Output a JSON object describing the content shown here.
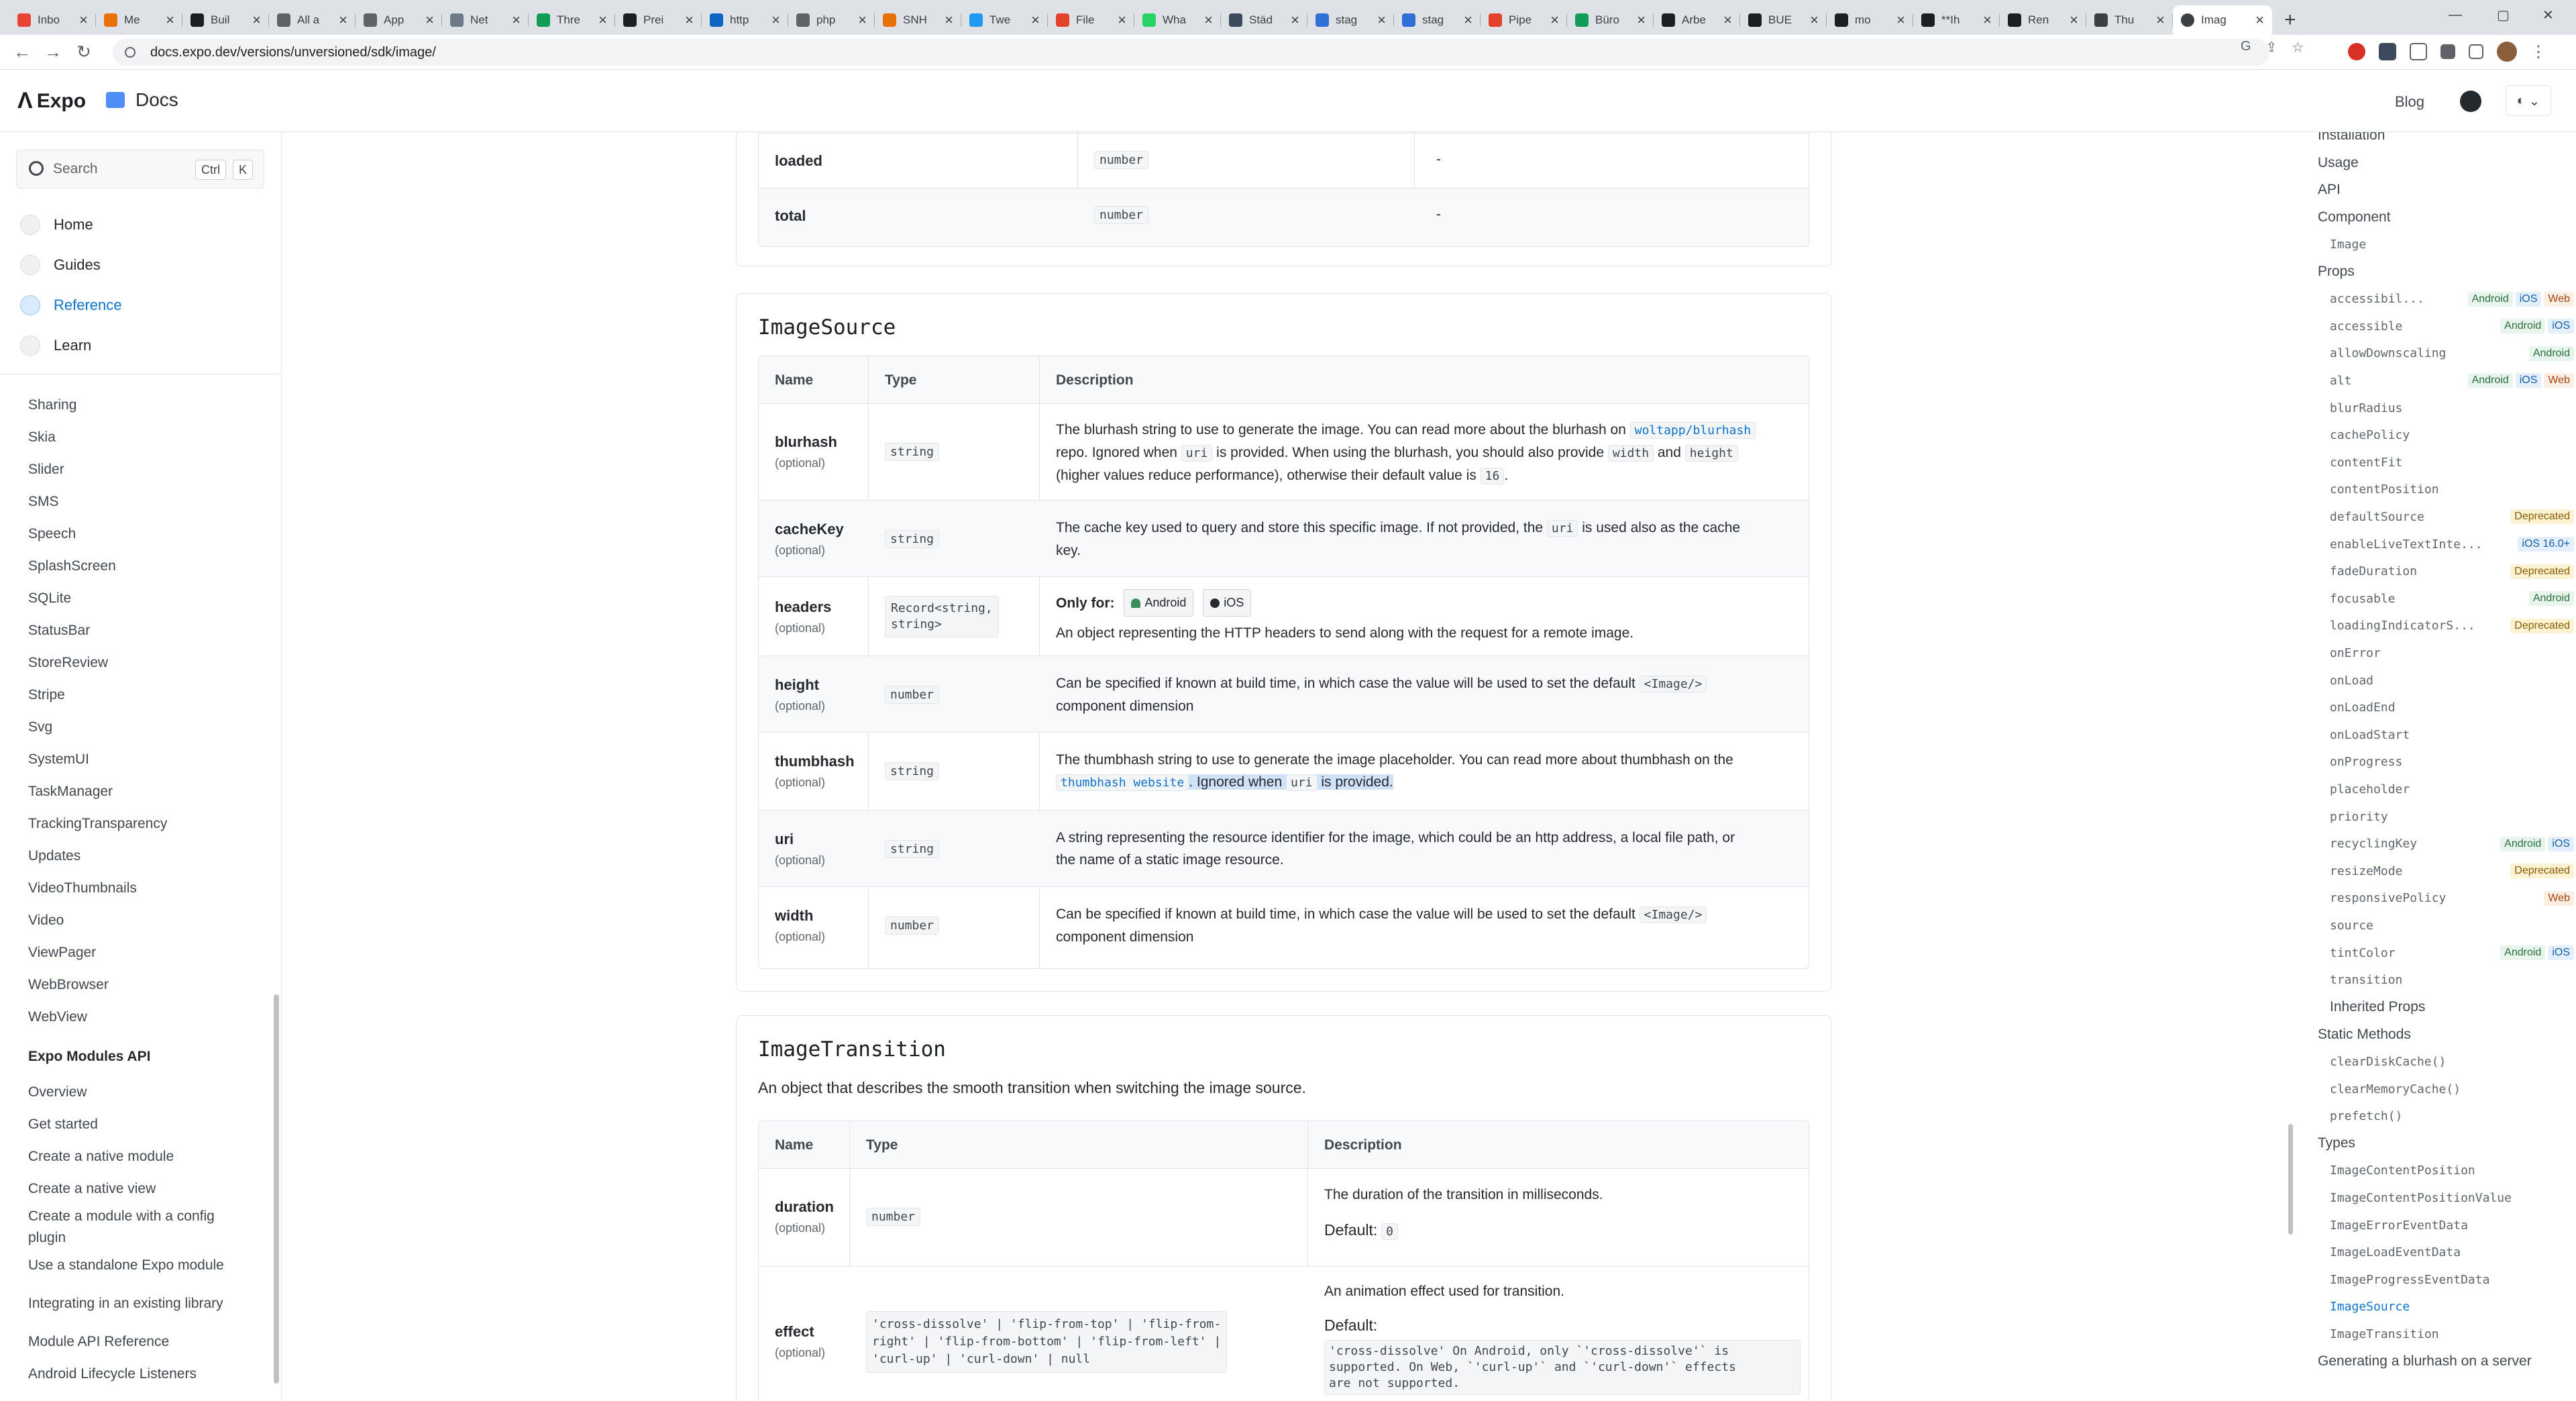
{
  "browser": {
    "tabs": [
      "Inbo",
      "Me",
      "Buil",
      "All a",
      "App",
      "Net",
      "Thre",
      "Prei",
      "http",
      "php",
      "SNH",
      "Twe",
      "File",
      "Wha",
      "Städ",
      "stag",
      "stag",
      "Pipe",
      "Büro",
      "Arbe",
      "BUE",
      "mo",
      "**Ih",
      "Ren",
      "Thu"
    ],
    "active_tab": "Imag",
    "url": "docs.expo.dev/versions/unversioned/sdk/image/",
    "colors": {
      "tabbar": "#dee1e6",
      "accent": "#0d74ce"
    }
  },
  "header": {
    "logo": "Expo",
    "section": "Docs",
    "blog": "Blog"
  },
  "sidebar": {
    "search_placeholder": "Search",
    "kbd_ctrl": "Ctrl",
    "kbd_k": "K",
    "main": [
      "Home",
      "Guides",
      "Reference",
      "Learn"
    ],
    "active": "Reference",
    "items": [
      "Sharing",
      "Skia",
      "Slider",
      "SMS",
      "Speech",
      "SplashScreen",
      "SQLite",
      "StatusBar",
      "StoreReview",
      "Stripe",
      "Svg",
      "SystemUI",
      "TaskManager",
      "TrackingTransparency",
      "Updates",
      "VideoThumbnails",
      "Video",
      "ViewPager",
      "WebBrowser",
      "WebView"
    ],
    "modules_heading": "Expo Modules API",
    "modules_items": [
      "Overview",
      "Get started",
      "Create a native module",
      "Create a native view",
      "Create a module with a config plugin",
      "Use a standalone Expo module",
      "Integrating in an existing library",
      "Module API Reference",
      "Android Lifecycle Listeners"
    ]
  },
  "progress_table": {
    "rows": [
      {
        "name": "loaded",
        "type": "number",
        "desc": "-"
      },
      {
        "name": "total",
        "type": "number",
        "desc": "-"
      }
    ]
  },
  "image_source": {
    "title": "ImageSource",
    "headers": [
      "Name",
      "Type",
      "Description"
    ],
    "optional": "(optional)",
    "rows": {
      "blurhash": {
        "name": "blurhash",
        "type": "string",
        "d1": "The blurhash string to use to generate the image. You can read more about the blurhash on ",
        "link": "woltapp/blurhash",
        "d2": "repo. Ignored when ",
        "c1": "uri",
        "d3": " is provided. When using the blurhash, you should also provide ",
        "c2": "width",
        "d4": " and ",
        "c3": "height",
        "d5": "(higher values reduce performance), otherwise their default value is ",
        "c4": "16",
        "d6": "."
      },
      "cacheKey": {
        "name": "cacheKey",
        "type": "string",
        "d1": "The cache key used to query and store this specific image. If not provided, the ",
        "c1": "uri",
        "d2": " is used also as the cache",
        "d3": "key."
      },
      "headers": {
        "name": "headers",
        "type_l1": "Record<string,",
        "type_l2": "string>",
        "only_for": "Only for:",
        "b1": "Android",
        "b2": "iOS",
        "d1": "An object representing the HTTP headers to send along with the request for a remote image."
      },
      "height": {
        "name": "height",
        "type": "number",
        "d1": "Can be specified if known at build time, in which case the value will be used to set the default ",
        "c1": "<Image/>",
        "d2": "component dimension"
      },
      "thumbhash": {
        "name": "thumbhash",
        "type": "string",
        "d1": "The thumbhash string to use to generate the image placeholder. You can read more about thumbhash on the",
        "link": "thumbhash website",
        "d2": ". Ignored when ",
        "c1": "uri",
        "d3": " is provided."
      },
      "uri": {
        "name": "uri",
        "type": "string",
        "d1": "A string representing the resource identifier for the image, which could be an http address, a local file path, or",
        "d2": "the name of a static image resource."
      },
      "width": {
        "name": "width",
        "type": "number",
        "d1": "Can be specified if known at build time, in which case the value will be used to set the default ",
        "c1": "<Image/>",
        "d2": "component dimension"
      }
    }
  },
  "image_transition": {
    "title": "ImageTransition",
    "subtitle": "An object that describes the smooth transition when switching the image source.",
    "headers": [
      "Name",
      "Type",
      "Description"
    ],
    "duration": {
      "name": "duration",
      "type": "number",
      "desc": "The duration of the transition in milliseconds.",
      "default_label": "Default:",
      "default_value": "0"
    },
    "effect": {
      "name": "effect",
      "type_l1": "'cross-dissolve' | 'flip-from-top' | 'flip-from-",
      "type_l2": "right' | 'flip-from-bottom' | 'flip-from-left' |",
      "type_l3": "'curl-up' | 'curl-down' | null",
      "desc": "An animation effect used for transition.",
      "default_label": "Default:",
      "default_l1": "'cross-dissolve' On Android, only `'cross-dissolve'` is",
      "default_l2": "supported. On Web, `'curl-up'` and `'curl-down'` effects",
      "default_l3": "are not supported."
    }
  },
  "toc": {
    "items": [
      {
        "label": "Installation",
        "level": 0
      },
      {
        "label": "Usage",
        "level": 0
      },
      {
        "label": "API",
        "level": 0
      },
      {
        "label": "Component",
        "level": 0
      },
      {
        "label": "Image",
        "level": 1
      },
      {
        "label": "Props",
        "level": 0
      },
      {
        "label": "accessibil...",
        "level": 1,
        "badges": [
          "Android",
          "iOS",
          "Web"
        ]
      },
      {
        "label": "accessible",
        "level": 1,
        "badges": [
          "Android",
          "iOS"
        ]
      },
      {
        "label": "allowDownscaling",
        "level": 1,
        "badges": [
          "Android"
        ]
      },
      {
        "label": "alt",
        "level": 1,
        "badges": [
          "Android",
          "iOS",
          "Web"
        ]
      },
      {
        "label": "blurRadius",
        "level": 1
      },
      {
        "label": "cachePolicy",
        "level": 1
      },
      {
        "label": "contentFit",
        "level": 1
      },
      {
        "label": "contentPosition",
        "level": 1
      },
      {
        "label": "defaultSource",
        "level": 1,
        "badges": [
          "Deprecated"
        ]
      },
      {
        "label": "enableLiveTextInte...",
        "level": 1,
        "badges": [
          "iOS 16.0+"
        ]
      },
      {
        "label": "fadeDuration",
        "level": 1,
        "badges": [
          "Deprecated"
        ]
      },
      {
        "label": "focusable",
        "level": 1,
        "badges": [
          "Android"
        ]
      },
      {
        "label": "loadingIndicatorS...",
        "level": 1,
        "badges": [
          "Deprecated"
        ]
      },
      {
        "label": "onError",
        "level": 1
      },
      {
        "label": "onLoad",
        "level": 1
      },
      {
        "label": "onLoadEnd",
        "level": 1
      },
      {
        "label": "onLoadStart",
        "level": 1
      },
      {
        "label": "onProgress",
        "level": 1
      },
      {
        "label": "placeholder",
        "level": 1
      },
      {
        "label": "priority",
        "level": 1
      },
      {
        "label": "recyclingKey",
        "level": 1,
        "badges": [
          "Android",
          "iOS"
        ]
      },
      {
        "label": "resizeMode",
        "level": 1,
        "badges": [
          "Deprecated"
        ]
      },
      {
        "label": "responsivePolicy",
        "level": 1,
        "badges": [
          "Web"
        ]
      },
      {
        "label": "source",
        "level": 1
      },
      {
        "label": "tintColor",
        "level": 1,
        "badges": [
          "Android",
          "iOS"
        ]
      },
      {
        "label": "transition",
        "level": 1
      },
      {
        "label": "Inherited Props",
        "level": 1,
        "plain": true
      },
      {
        "label": "Static Methods",
        "level": 0
      },
      {
        "label": "clearDiskCache()",
        "level": 1
      },
      {
        "label": "clearMemoryCache()",
        "level": 1
      },
      {
        "label": "prefetch()",
        "level": 1
      },
      {
        "label": "Types",
        "level": 0
      },
      {
        "label": "ImageContentPosition",
        "level": 1
      },
      {
        "label": "ImageContentPositionValue",
        "level": 1
      },
      {
        "label": "ImageErrorEventData",
        "level": 1
      },
      {
        "label": "ImageLoadEventData",
        "level": 1
      },
      {
        "label": "ImageProgressEventData",
        "level": 1
      },
      {
        "label": "ImageSource",
        "level": 1,
        "active": true
      },
      {
        "label": "ImageTransition",
        "level": 1
      },
      {
        "label": "Generating a blurhash on a server",
        "level": 0
      }
    ]
  }
}
